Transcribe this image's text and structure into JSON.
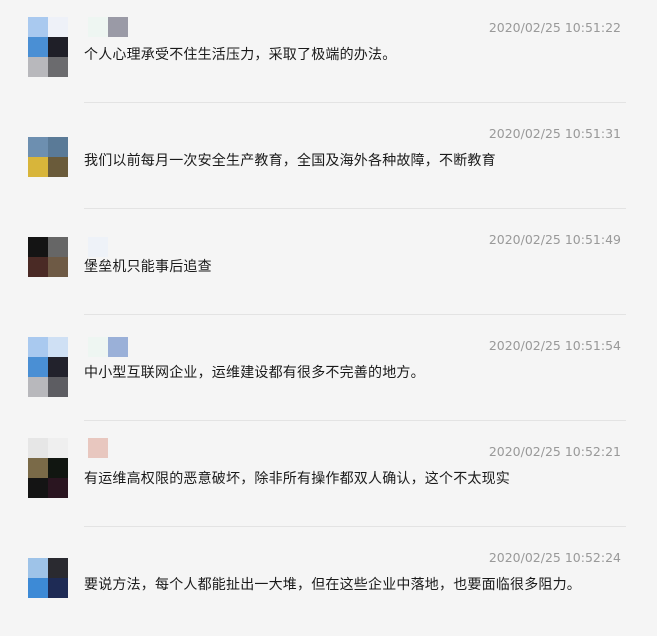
{
  "messages": [
    {
      "timestamp": "2020/02/25 10:51:22",
      "text": "个人心理承受不住生活压力，采取了极端的办法。",
      "avatar_colors": [
        "#a9c9ef",
        "#eef1f8",
        "#4a8fd4",
        "#1f1f28",
        "#b8b8bc",
        "#6b6b6e"
      ],
      "name_colors": [
        "#eef6f2",
        "#9a9aa6"
      ]
    },
    {
      "timestamp": "2020/02/25 10:51:31",
      "text": "我们以前每月一次安全生产教育，全国及海外各种故障，不断教育",
      "avatar_colors": [
        "#6d8fb0",
        "#5a7a97",
        "#d8b53a",
        "#6a5b3a"
      ],
      "name_colors": []
    },
    {
      "timestamp": "2020/02/25 10:51:49",
      "text": "堡垒机只能事后追查",
      "avatar_colors": [
        "#141414",
        "#666666",
        "#4a2a25",
        "#6e5a45"
      ],
      "name_colors": [
        "#eef2f8"
      ]
    },
    {
      "timestamp": "2020/02/25 10:51:54",
      "text": "中小型互联网企业，运维建设都有很多不完善的地方。",
      "avatar_colors": [
        "#a9c9ef",
        "#cfe0f4",
        "#4a8fd4",
        "#22222c",
        "#b8b8bc",
        "#5d5d62"
      ],
      "name_colors": [
        "#eef6f2",
        "#9ab0d8"
      ]
    },
    {
      "timestamp": "2020/02/25 10:52:21",
      "text": "有运维高权限的恶意破坏，除非所有操作都双人确认，这个不太现实",
      "avatar_colors": [
        "#e6e6e6",
        "#efefef",
        "#7a6a48",
        "#111611",
        "#141414",
        "#2a1520"
      ],
      "name_colors": [
        "#e8c7bf"
      ]
    },
    {
      "timestamp": "2020/02/25 10:52:24",
      "text": "要说方法，每个人都能扯出一大堆，但在这些企业中落地，也要面临很多阻力。",
      "avatar_colors": [
        "#9ec3e8",
        "#2a2a30",
        "#3d8ad6",
        "#1e2b55"
      ],
      "name_colors": []
    }
  ]
}
